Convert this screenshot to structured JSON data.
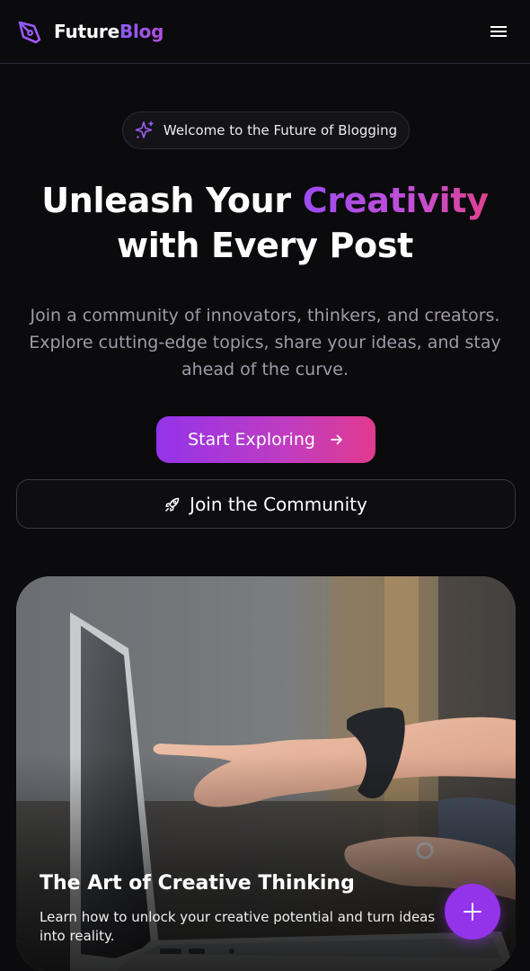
{
  "header": {
    "brand_first": "Future",
    "brand_second": "Blog",
    "logo_icon": "pen-nib-icon",
    "menu_icon": "hamburger-menu-icon"
  },
  "hero": {
    "badge_icon": "sparkles-icon",
    "badge_text": "Welcome to the Future of Blogging",
    "title_part1": "Unleash Your ",
    "title_accent": "Creativity",
    "title_part2": "with Every Post",
    "subtitle": "Join a community of innovators, thinkers, and creators. Explore cutting-edge topics, share your ideas, and stay ahead of the curve.",
    "primary_button": "Start Exploring",
    "primary_button_icon": "arrow-right-icon",
    "secondary_button": "Join the Community",
    "secondary_button_icon": "rocket-icon"
  },
  "featured": {
    "title": "The Art of Creative Thinking",
    "text": "Learn how to unlock your creative potential and turn ideas into reality."
  },
  "fab": {
    "icon": "plus-icon"
  },
  "colors": {
    "background": "#0b0a0d",
    "accent_purple": "#9333ea",
    "accent_pink": "#e23a8e",
    "muted_text": "#9f9ba8"
  }
}
